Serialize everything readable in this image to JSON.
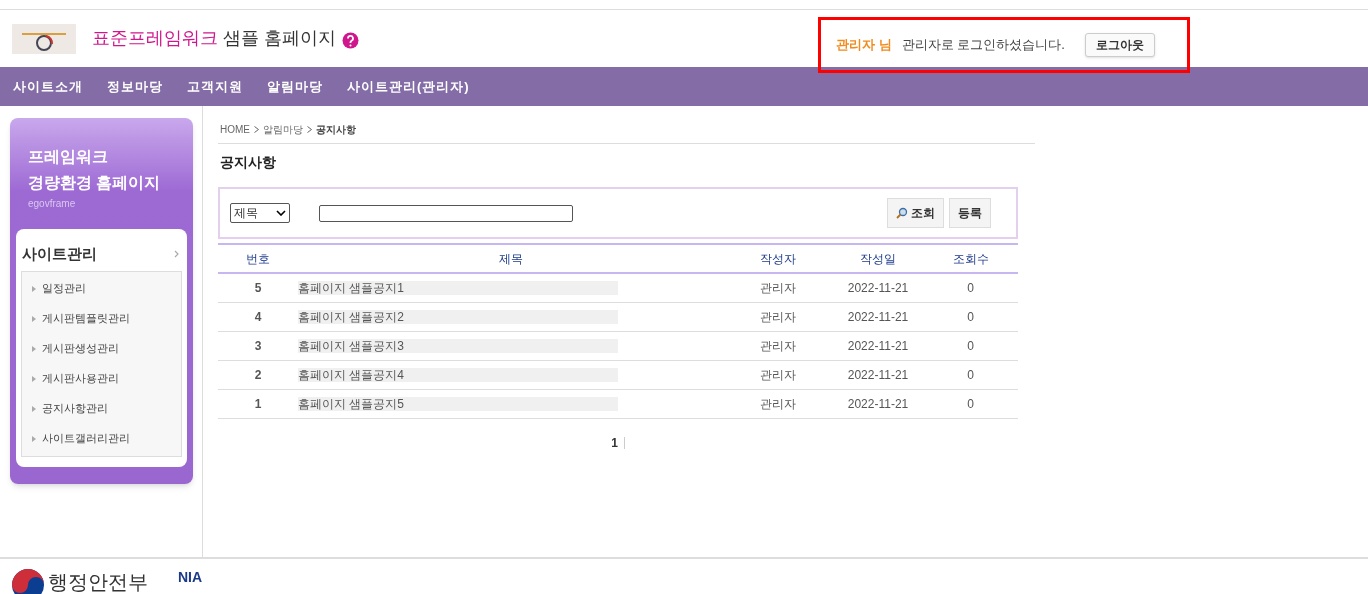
{
  "header": {
    "site_title_highlight": "표준프레임워크",
    "site_title_rest": "샘플 홈페이지",
    "user_name": "관리자 님",
    "login_message": "관리자로 로그인하셨습니다.",
    "logout_button": "로그아웃"
  },
  "nav": [
    {
      "label": "사이트소개"
    },
    {
      "label": "정보마당"
    },
    {
      "label": "고객지원"
    },
    {
      "label": "알림마당"
    },
    {
      "label": "사이트관리(관리자)"
    }
  ],
  "sidebar": {
    "title_lines": [
      "프레임워크",
      "경량환경 홈페이지"
    ],
    "subtitle": "egovframe",
    "section": "사이트관리",
    "items": [
      {
        "label": "일정관리"
      },
      {
        "label": "게시판템플릿관리"
      },
      {
        "label": "게시판생성관리"
      },
      {
        "label": "게시판사용관리"
      },
      {
        "label": "공지사항관리"
      },
      {
        "label": "사이트갤러리관리"
      }
    ]
  },
  "breadcrumb": [
    {
      "label": "HOME",
      "current": false
    },
    {
      "label": "알림마당",
      "current": false
    },
    {
      "label": "공지사항",
      "current": true
    }
  ],
  "page_title": "공지사항",
  "search": {
    "select_value": "제목",
    "search_button": "조회",
    "register_button": "등록"
  },
  "table": {
    "columns": [
      "번호",
      "제목",
      "작성자",
      "작성일",
      "조회수"
    ],
    "rows": [
      [
        "5",
        "홈페이지 샘플공지1",
        "관리자",
        "2022-11-21",
        "0"
      ],
      [
        "4",
        "홈페이지 샘플공지2",
        "관리자",
        "2022-11-21",
        "0"
      ],
      [
        "3",
        "홈페이지 샘플공지3",
        "관리자",
        "2022-11-21",
        "0"
      ],
      [
        "2",
        "홈페이지 샘플공지4",
        "관리자",
        "2022-11-21",
        "0"
      ],
      [
        "1",
        "홈페이지 샘플공지5",
        "관리자",
        "2022-11-21",
        "0"
      ]
    ]
  },
  "pagination": [
    {
      "label": "1",
      "selected": true
    }
  ],
  "footer": {
    "ministry": "행정안전부",
    "agency": "NIA"
  }
}
